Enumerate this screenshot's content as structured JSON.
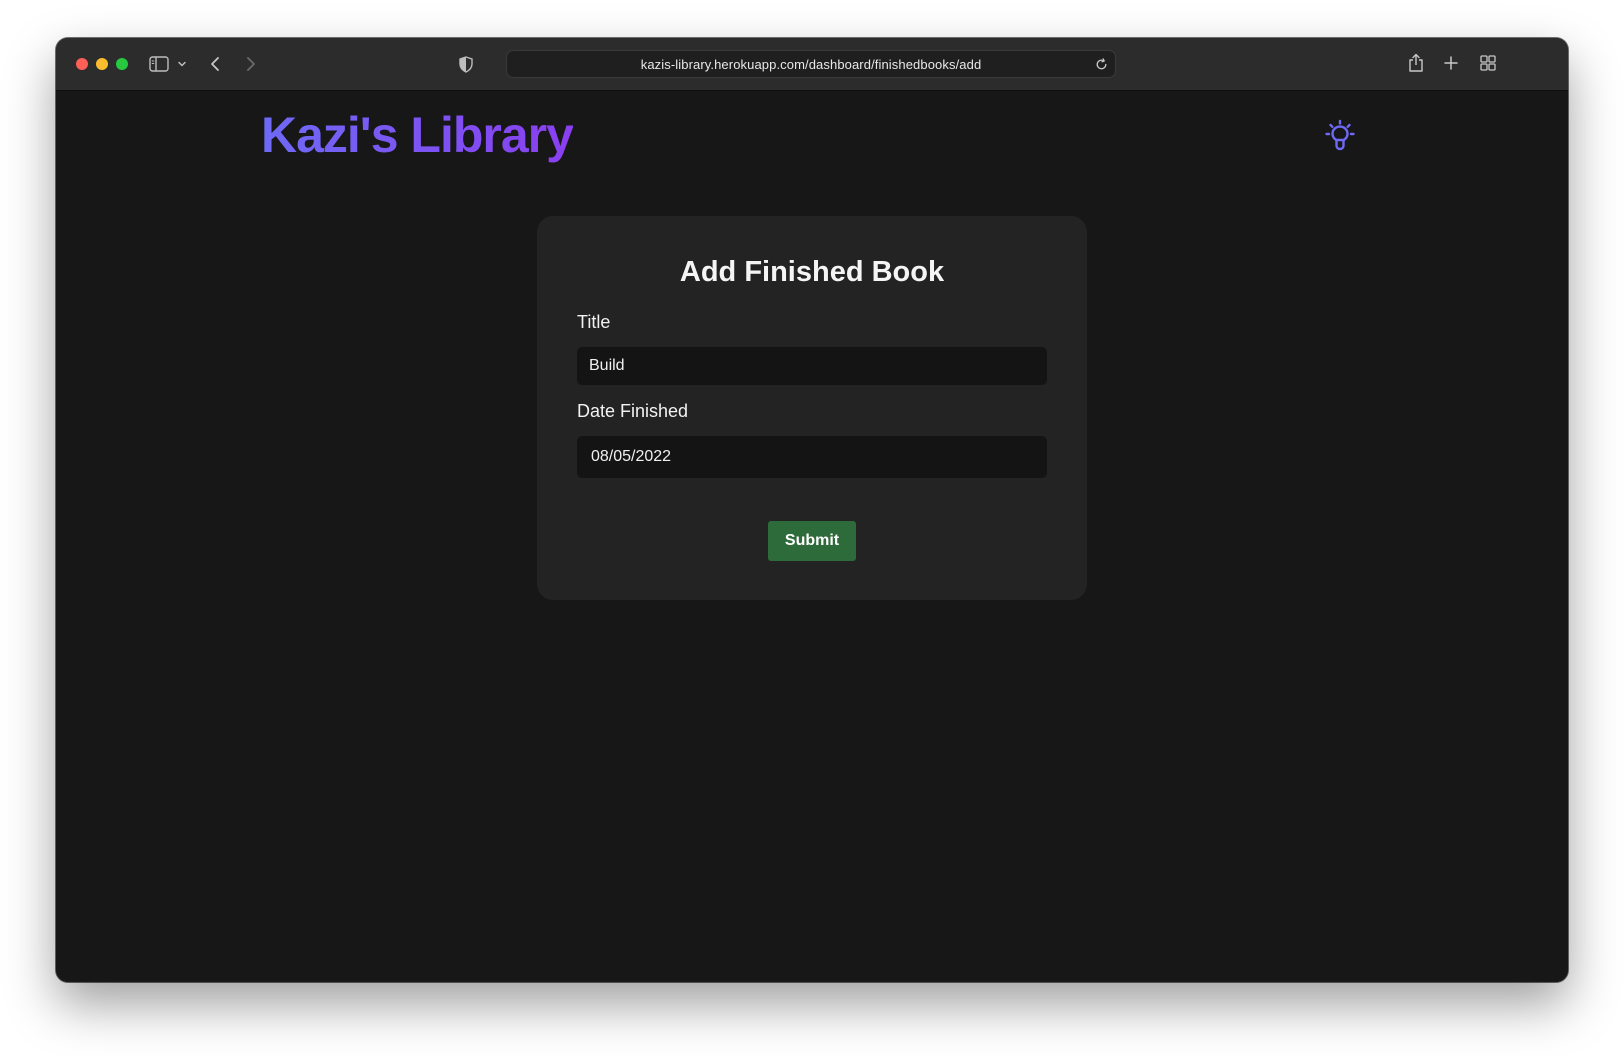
{
  "browser": {
    "url": "kazis-library.herokuapp.com/dashboard/finishedbooks/add"
  },
  "header": {
    "brand": "Kazi's Library",
    "theme_toggle_icon": "lightbulb-icon",
    "brand_gradient": [
      "#6e6af5",
      "#8a3ff0"
    ]
  },
  "form": {
    "title": "Add Finished Book",
    "fields": [
      {
        "label": "Title",
        "value": "Build"
      },
      {
        "label": "Date Finished",
        "value": "08/05/2022"
      }
    ],
    "submit_label": "Submit"
  },
  "colors": {
    "page_bg": "#171717",
    "card_bg": "#232323",
    "input_bg": "#141414",
    "submit_bg": "#2e6b3a",
    "accent": "#6e6af5"
  }
}
